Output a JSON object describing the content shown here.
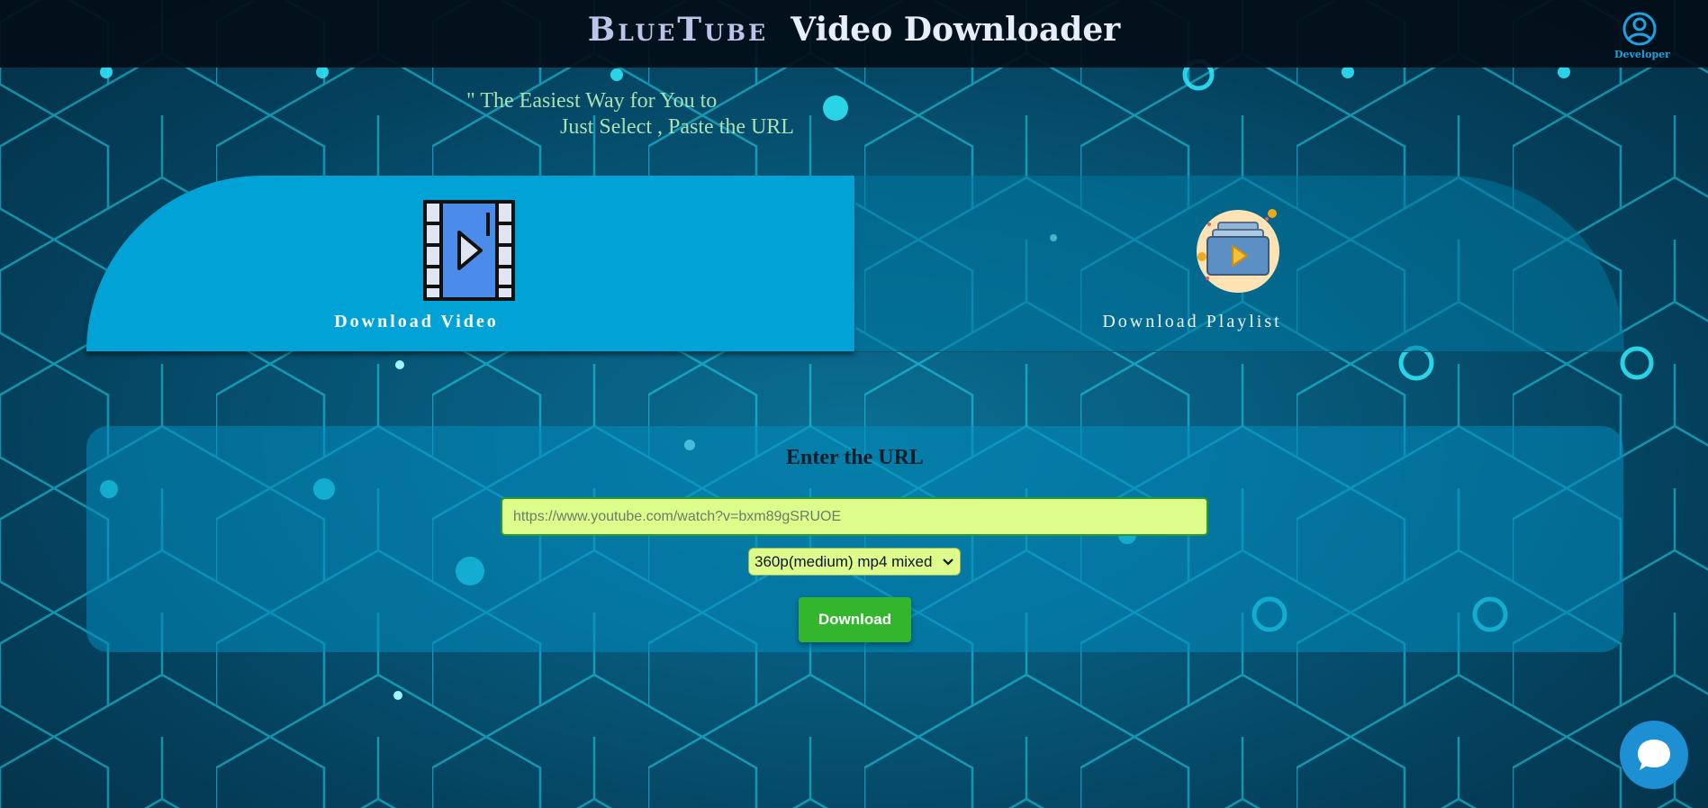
{
  "header": {
    "brand_part1": "BlueTube",
    "brand_part2": "Video Downloader",
    "developer_label": "Developer"
  },
  "tagline": {
    "line1": "\" The Easiest Way for You to",
    "line2": "Just Select , Paste the URL"
  },
  "tabs": [
    {
      "label": "Download Video",
      "active": true,
      "icon": "video-file-icon"
    },
    {
      "label": "Download Playlist",
      "active": false,
      "icon": "playlist-icon"
    }
  ],
  "form": {
    "title": "Enter the URL",
    "url_placeholder": "https://www.youtube.com/watch?v=bxm89gSRUOE",
    "quality_selected": "360p(medium) mp4 mixed",
    "download_label": "Download"
  },
  "colors": {
    "accent_blue": "#01a3d6",
    "input_bg": "#ddfc8c",
    "download_green": "#33b52d"
  }
}
